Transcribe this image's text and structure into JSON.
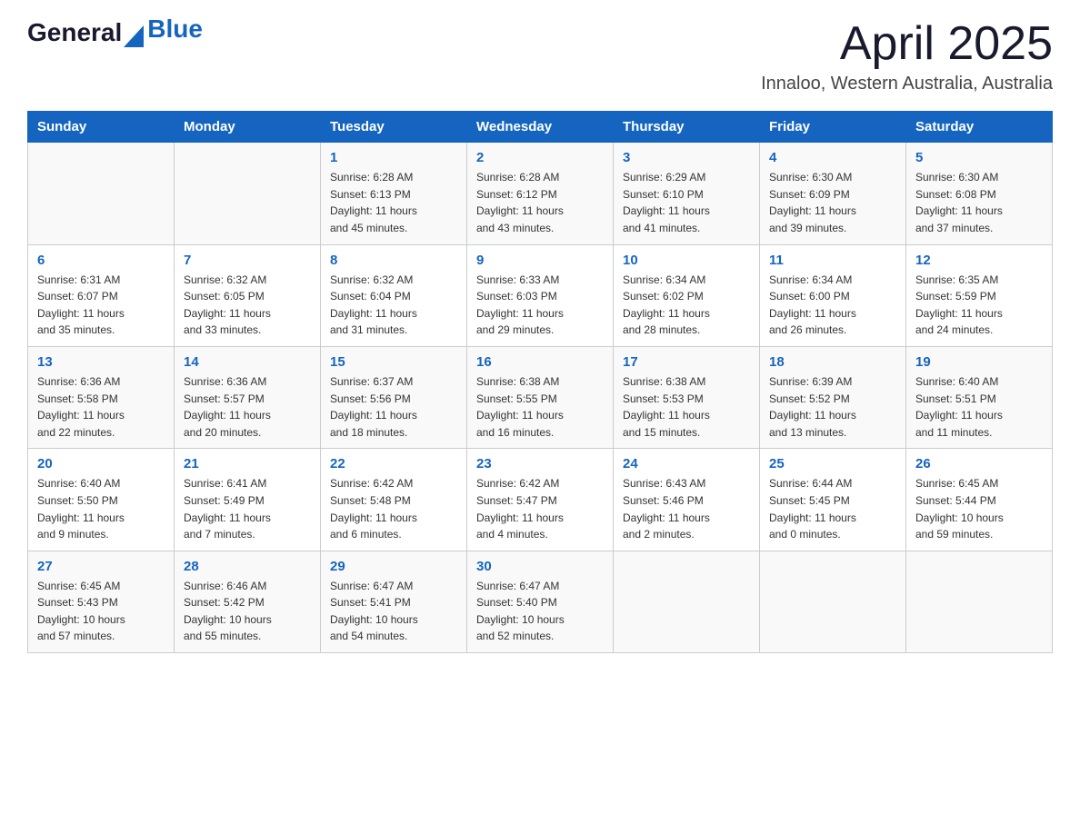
{
  "header": {
    "logo_general": "General",
    "logo_blue": "Blue",
    "month": "April 2025",
    "location": "Innaloo, Western Australia, Australia"
  },
  "days_of_week": [
    "Sunday",
    "Monday",
    "Tuesday",
    "Wednesday",
    "Thursday",
    "Friday",
    "Saturday"
  ],
  "weeks": [
    [
      {
        "day": "",
        "info": ""
      },
      {
        "day": "",
        "info": ""
      },
      {
        "day": "1",
        "info": "Sunrise: 6:28 AM\nSunset: 6:13 PM\nDaylight: 11 hours\nand 45 minutes."
      },
      {
        "day": "2",
        "info": "Sunrise: 6:28 AM\nSunset: 6:12 PM\nDaylight: 11 hours\nand 43 minutes."
      },
      {
        "day": "3",
        "info": "Sunrise: 6:29 AM\nSunset: 6:10 PM\nDaylight: 11 hours\nand 41 minutes."
      },
      {
        "day": "4",
        "info": "Sunrise: 6:30 AM\nSunset: 6:09 PM\nDaylight: 11 hours\nand 39 minutes."
      },
      {
        "day": "5",
        "info": "Sunrise: 6:30 AM\nSunset: 6:08 PM\nDaylight: 11 hours\nand 37 minutes."
      }
    ],
    [
      {
        "day": "6",
        "info": "Sunrise: 6:31 AM\nSunset: 6:07 PM\nDaylight: 11 hours\nand 35 minutes."
      },
      {
        "day": "7",
        "info": "Sunrise: 6:32 AM\nSunset: 6:05 PM\nDaylight: 11 hours\nand 33 minutes."
      },
      {
        "day": "8",
        "info": "Sunrise: 6:32 AM\nSunset: 6:04 PM\nDaylight: 11 hours\nand 31 minutes."
      },
      {
        "day": "9",
        "info": "Sunrise: 6:33 AM\nSunset: 6:03 PM\nDaylight: 11 hours\nand 29 minutes."
      },
      {
        "day": "10",
        "info": "Sunrise: 6:34 AM\nSunset: 6:02 PM\nDaylight: 11 hours\nand 28 minutes."
      },
      {
        "day": "11",
        "info": "Sunrise: 6:34 AM\nSunset: 6:00 PM\nDaylight: 11 hours\nand 26 minutes."
      },
      {
        "day": "12",
        "info": "Sunrise: 6:35 AM\nSunset: 5:59 PM\nDaylight: 11 hours\nand 24 minutes."
      }
    ],
    [
      {
        "day": "13",
        "info": "Sunrise: 6:36 AM\nSunset: 5:58 PM\nDaylight: 11 hours\nand 22 minutes."
      },
      {
        "day": "14",
        "info": "Sunrise: 6:36 AM\nSunset: 5:57 PM\nDaylight: 11 hours\nand 20 minutes."
      },
      {
        "day": "15",
        "info": "Sunrise: 6:37 AM\nSunset: 5:56 PM\nDaylight: 11 hours\nand 18 minutes."
      },
      {
        "day": "16",
        "info": "Sunrise: 6:38 AM\nSunset: 5:55 PM\nDaylight: 11 hours\nand 16 minutes."
      },
      {
        "day": "17",
        "info": "Sunrise: 6:38 AM\nSunset: 5:53 PM\nDaylight: 11 hours\nand 15 minutes."
      },
      {
        "day": "18",
        "info": "Sunrise: 6:39 AM\nSunset: 5:52 PM\nDaylight: 11 hours\nand 13 minutes."
      },
      {
        "day": "19",
        "info": "Sunrise: 6:40 AM\nSunset: 5:51 PM\nDaylight: 11 hours\nand 11 minutes."
      }
    ],
    [
      {
        "day": "20",
        "info": "Sunrise: 6:40 AM\nSunset: 5:50 PM\nDaylight: 11 hours\nand 9 minutes."
      },
      {
        "day": "21",
        "info": "Sunrise: 6:41 AM\nSunset: 5:49 PM\nDaylight: 11 hours\nand 7 minutes."
      },
      {
        "day": "22",
        "info": "Sunrise: 6:42 AM\nSunset: 5:48 PM\nDaylight: 11 hours\nand 6 minutes."
      },
      {
        "day": "23",
        "info": "Sunrise: 6:42 AM\nSunset: 5:47 PM\nDaylight: 11 hours\nand 4 minutes."
      },
      {
        "day": "24",
        "info": "Sunrise: 6:43 AM\nSunset: 5:46 PM\nDaylight: 11 hours\nand 2 minutes."
      },
      {
        "day": "25",
        "info": "Sunrise: 6:44 AM\nSunset: 5:45 PM\nDaylight: 11 hours\nand 0 minutes."
      },
      {
        "day": "26",
        "info": "Sunrise: 6:45 AM\nSunset: 5:44 PM\nDaylight: 10 hours\nand 59 minutes."
      }
    ],
    [
      {
        "day": "27",
        "info": "Sunrise: 6:45 AM\nSunset: 5:43 PM\nDaylight: 10 hours\nand 57 minutes."
      },
      {
        "day": "28",
        "info": "Sunrise: 6:46 AM\nSunset: 5:42 PM\nDaylight: 10 hours\nand 55 minutes."
      },
      {
        "day": "29",
        "info": "Sunrise: 6:47 AM\nSunset: 5:41 PM\nDaylight: 10 hours\nand 54 minutes."
      },
      {
        "day": "30",
        "info": "Sunrise: 6:47 AM\nSunset: 5:40 PM\nDaylight: 10 hours\nand 52 minutes."
      },
      {
        "day": "",
        "info": ""
      },
      {
        "day": "",
        "info": ""
      },
      {
        "day": "",
        "info": ""
      }
    ]
  ]
}
